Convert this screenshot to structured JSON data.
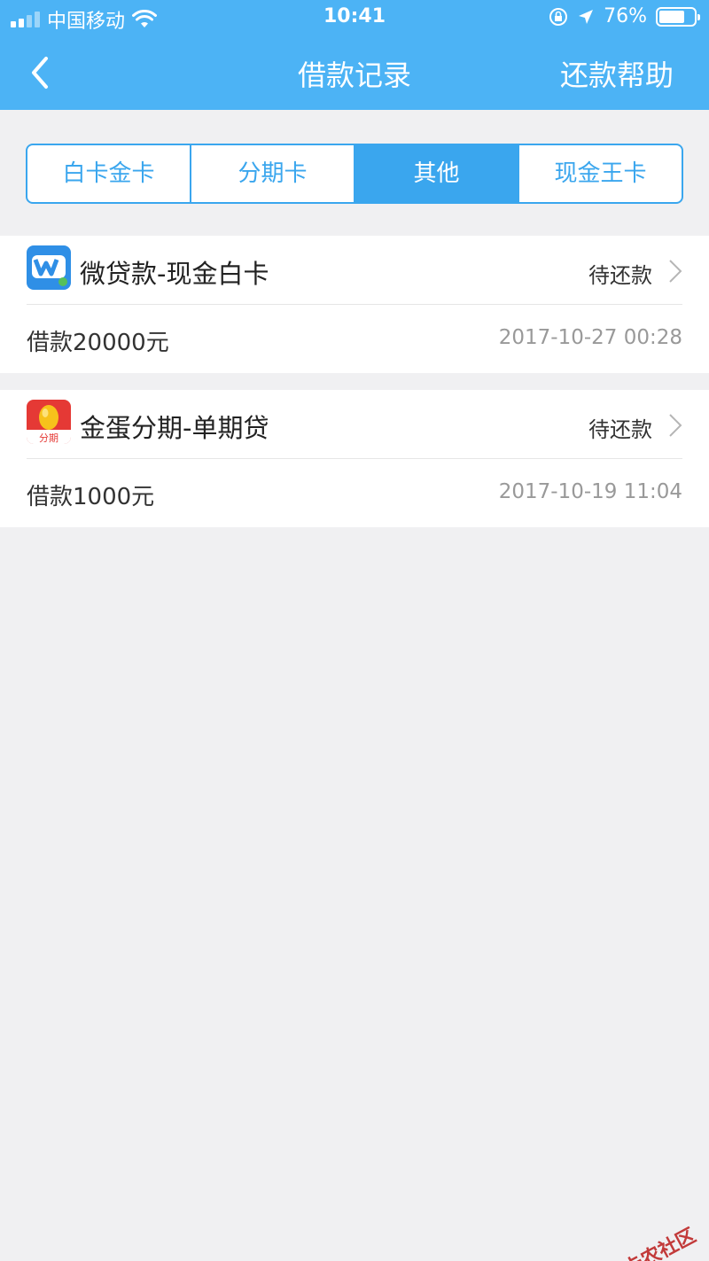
{
  "statusbar": {
    "carrier": "中国移动",
    "time": "10:41",
    "battery": "76%",
    "battery_level": 0.76
  },
  "navbar": {
    "title": "借款记录",
    "help": "还款帮助"
  },
  "tabs": [
    {
      "label": "白卡金卡",
      "active": false
    },
    {
      "label": "分期卡",
      "active": false
    },
    {
      "label": "其他",
      "active": true
    },
    {
      "label": "现金王卡",
      "active": false
    }
  ],
  "records": [
    {
      "name": "微贷款-现金白卡",
      "status": "待还款",
      "amount": "借款20000元",
      "date": "2017-10-27 00:28",
      "icon": "weidai-logo-icon",
      "icon_color": "#2f8fe6"
    },
    {
      "name": "金蛋分期-单期贷",
      "status": "待还款",
      "amount": "借款1000元",
      "date": "2017-10-19 11:04",
      "icon": "jindan-logo-icon",
      "icon_color": "#e53935",
      "icon_text": "分期"
    }
  ],
  "watermark": "卡农社区",
  "colors": {
    "header": "#4cb3f5",
    "tab_accent": "#3aa6ee",
    "background": "#f0f0f2"
  }
}
